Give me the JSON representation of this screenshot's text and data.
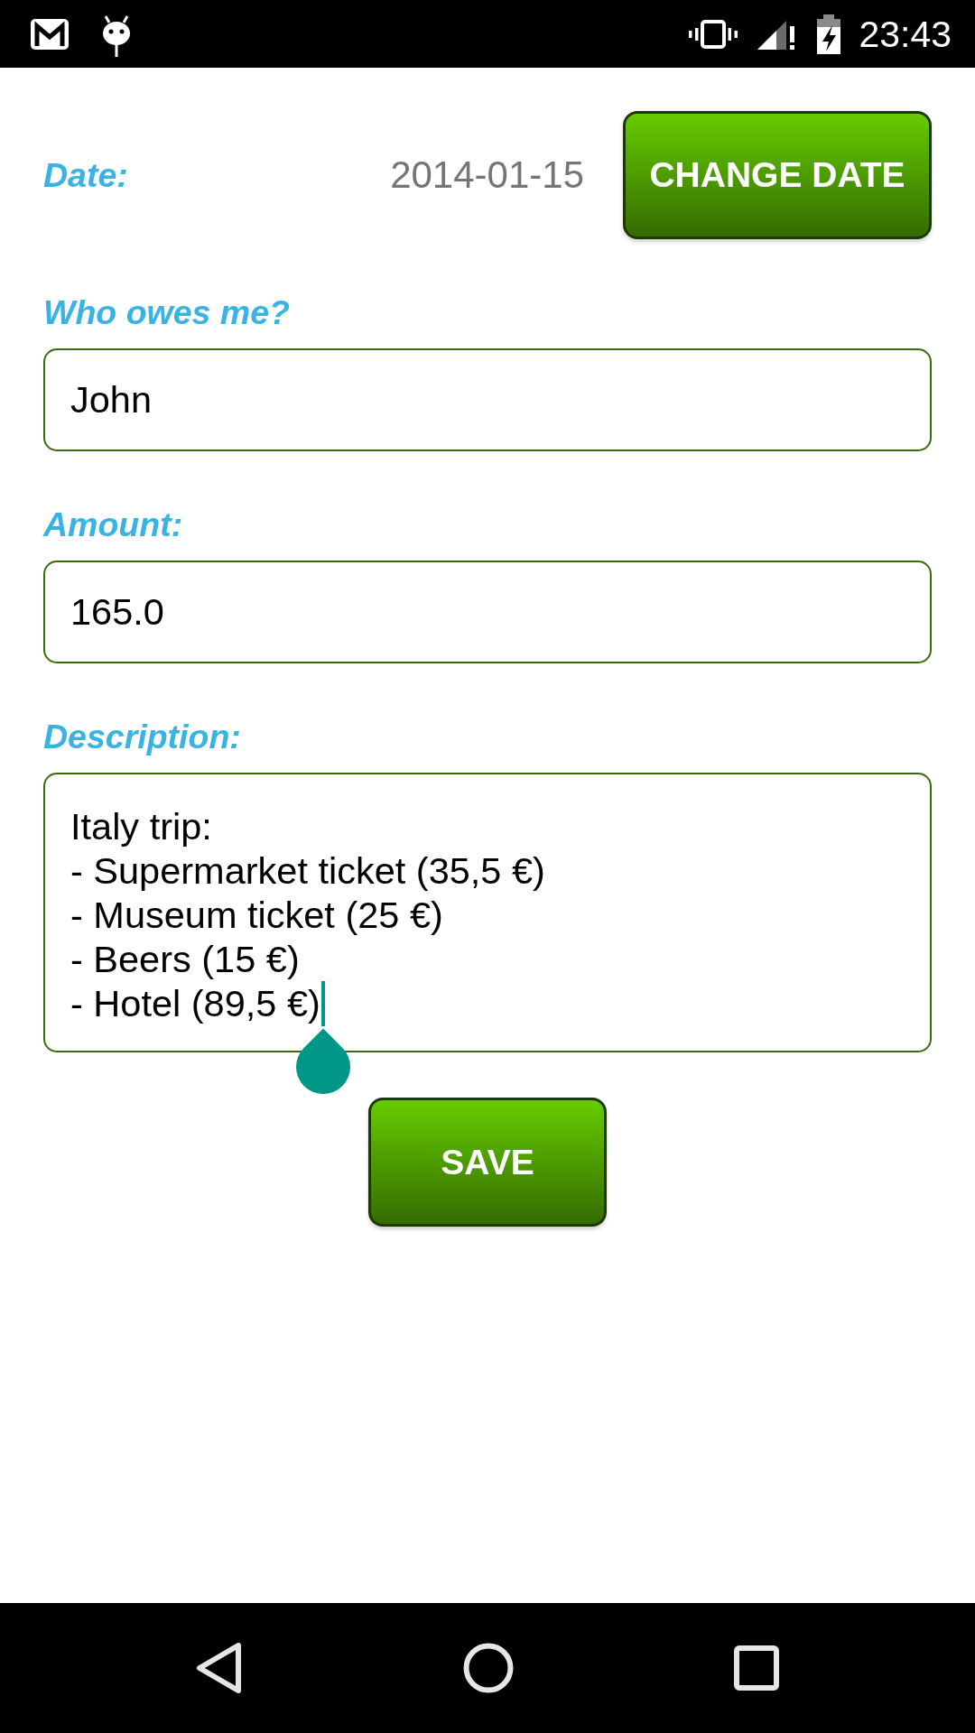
{
  "status_bar": {
    "time": "23:43"
  },
  "date_row": {
    "label": "Date:",
    "value": "2014-01-15",
    "button": "CHANGE DATE"
  },
  "fields": [
    {
      "kind": "single",
      "label": "Who owes me?",
      "value": "John",
      "focused": false
    },
    {
      "kind": "single",
      "label": "Amount:",
      "value": "165.0",
      "focused": false
    },
    {
      "kind": "multiline",
      "label": "Description:",
      "value": "Italy trip:\n- Supermarket ticket (35,5 €)\n- Museum ticket (25 €)\n- Beers (15 €)\n- Hotel (89,5 €)",
      "focused": true
    }
  ],
  "save_button": "SAVE"
}
